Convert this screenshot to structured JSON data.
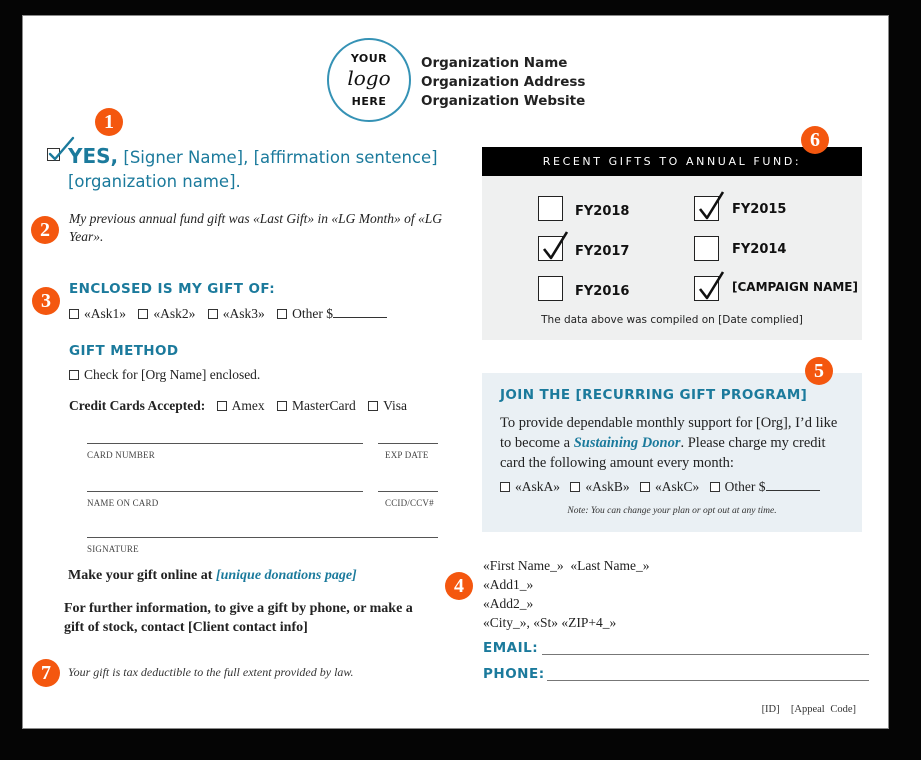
{
  "header": {
    "logo": {
      "line1": "YOUR",
      "line2": "logo",
      "line3": "HERE"
    },
    "org_lines": [
      "Organization Name",
      "Organization Address",
      "Organization Website"
    ]
  },
  "badges": [
    "1",
    "2",
    "3",
    "4",
    "5",
    "6",
    "7"
  ],
  "affirmation": {
    "checked": true,
    "yes": "YES,",
    "text": " [Signer Name], [affirmation sentence] [organization name]."
  },
  "previous_gift": "My previous annual fund gift was «Last Gift» in «LG Month» of «LG Year».",
  "enclosed": {
    "heading": "ENCLOSED IS MY GIFT OF:",
    "options": [
      "«Ask1»",
      "«Ask2»",
      "«Ask3»",
      "Other $"
    ]
  },
  "gift_method": {
    "heading": "GIFT METHOD",
    "check_option": "Check for [Org Name] enclosed.",
    "cards_label": "Credit Cards Accepted:",
    "cards": [
      "Amex",
      "MasterCard",
      "Visa"
    ]
  },
  "card_fields": {
    "card_number": "CARD NUMBER",
    "exp_date": "EXP DATE",
    "name_on_card": "NAME ON CARD",
    "ccv": "CCID/CCV#",
    "signature": "SIGNATURE"
  },
  "online": {
    "prefix": "Make your gift online at ",
    "link": "[unique donations page]"
  },
  "further_info": "For further information, to give a gift by phone, or make a gift of stock, contact [Client contact info]",
  "tax_note": "Your gift is tax deductible to the full extent provided by law.",
  "recent_gifts": {
    "title": "RECENT GIFTS TO ANNUAL FUND:",
    "items": [
      {
        "label": "FY2018",
        "checked": false
      },
      {
        "label": "FY2017",
        "checked": true
      },
      {
        "label": "FY2016",
        "checked": false
      },
      {
        "label": "FY2015",
        "checked": true
      },
      {
        "label": "FY2014",
        "checked": false
      },
      {
        "label": "[CAMPAIGN NAME]",
        "checked": true
      }
    ],
    "compiled_note": "The data above was compiled on [Date complied]"
  },
  "recurring": {
    "heading": "JOIN THE [RECURRING GIFT PROGRAM]",
    "body_before": "To provide dependable monthly support for [Org], I’d like to become a ",
    "body_emphasis": "Sustaining Donor",
    "body_after": ". Please charge my credit card the following amount every month:",
    "options": [
      "«AskA»",
      "«AskB»",
      "«AskC»",
      "Other $"
    ],
    "note": "Note: You can change your plan or opt out at any time."
  },
  "address": {
    "lines": [
      "«First Name_»  «Last Name_»",
      "«Add1_»",
      "«Add2_»",
      "«City_», «St» «ZIP+4_»"
    ]
  },
  "contact_fields": {
    "email_label": "EMAIL:",
    "phone_label": "PHONE:"
  },
  "codes": "[ID]  [Appeal Code]",
  "colors": {
    "accent": "#1b7a9c",
    "badge": "#f4570f",
    "recent_header": "#000000",
    "recent_bg": "#eff0f0",
    "recurring_bg": "#eaf0f4"
  }
}
